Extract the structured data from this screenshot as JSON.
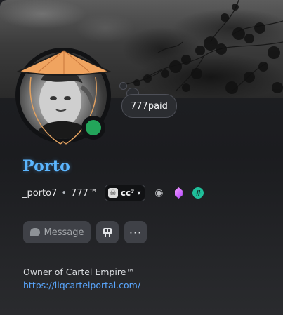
{
  "status": {
    "custom_status": "777paid",
    "online_color": "#23a55a"
  },
  "profile": {
    "display_name": "Porto",
    "username": "_porto7",
    "pronoun_tag": "777™",
    "guild_tag": "cc⁷",
    "bio": "Owner of Cartel Empire™",
    "link": "https://liqcartelportal.com/"
  },
  "badges": [
    "nitro-icon",
    "gem-icon",
    "hash-icon"
  ],
  "actions": {
    "message_label": "Message"
  },
  "colors": {
    "name": "#5bb6ff",
    "link": "#5aa7ff",
    "button_bg": "#3f4147"
  }
}
